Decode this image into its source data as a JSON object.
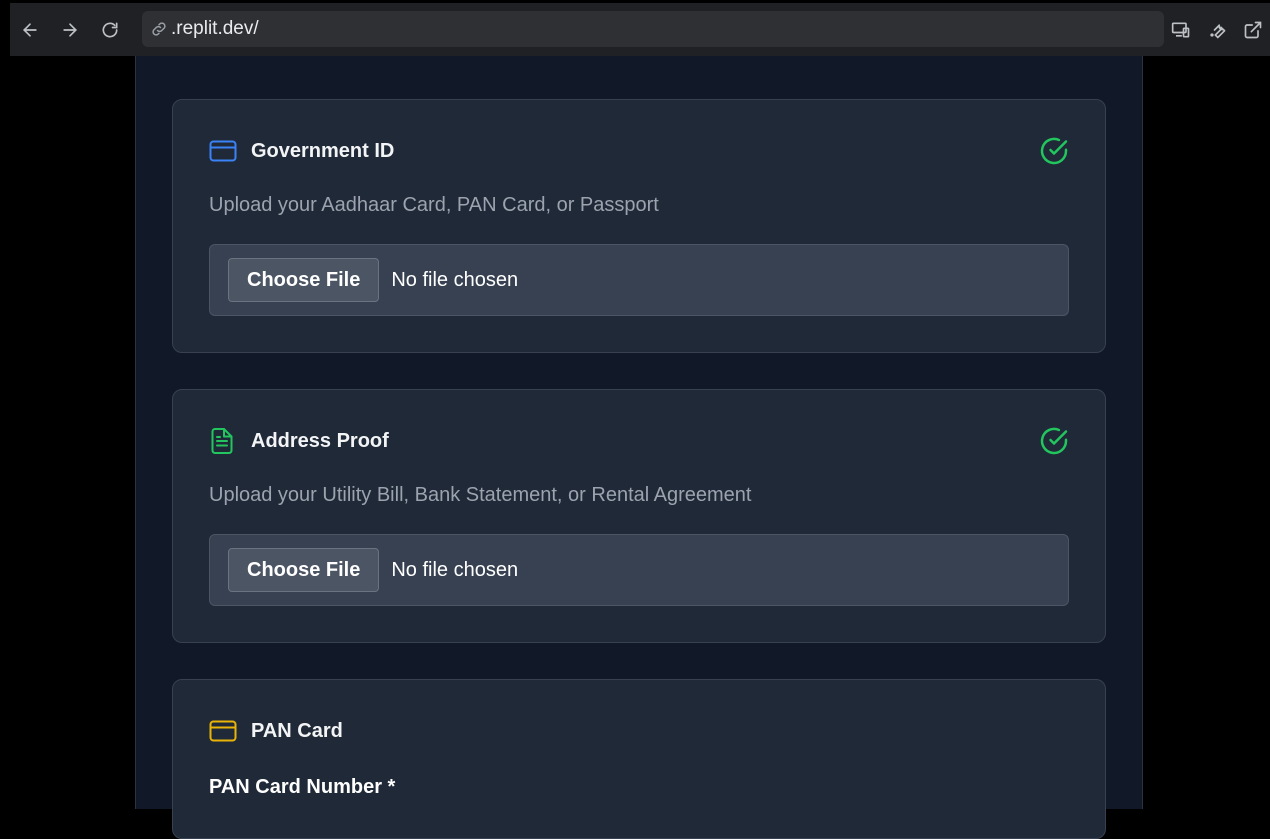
{
  "browser": {
    "url": ".replit.dev/"
  },
  "page": {
    "partial_heading": ""
  },
  "cards": [
    {
      "title": "Government ID",
      "icon": "credit-card-icon",
      "icon_color": "#3b82f6",
      "status": "check-circle-icon",
      "description": "Upload your Aadhaar Card, PAN Card, or Passport",
      "button_label": "Choose File",
      "file_status": "No file chosen"
    },
    {
      "title": "Address Proof",
      "icon": "file-text-icon",
      "icon_color": "#22c55e",
      "status": "check-circle-icon",
      "description": "Upload your Utility Bill, Bank Statement, or Rental Agreement",
      "button_label": "Choose File",
      "file_status": "No file chosen"
    },
    {
      "title": "PAN Card",
      "icon": "credit-card-icon",
      "icon_color": "#eab308",
      "field_label": "PAN Card Number *"
    }
  ],
  "colors": {
    "page_bg": "#111827",
    "card_bg": "#1f2937",
    "check_green": "#22c55e"
  }
}
